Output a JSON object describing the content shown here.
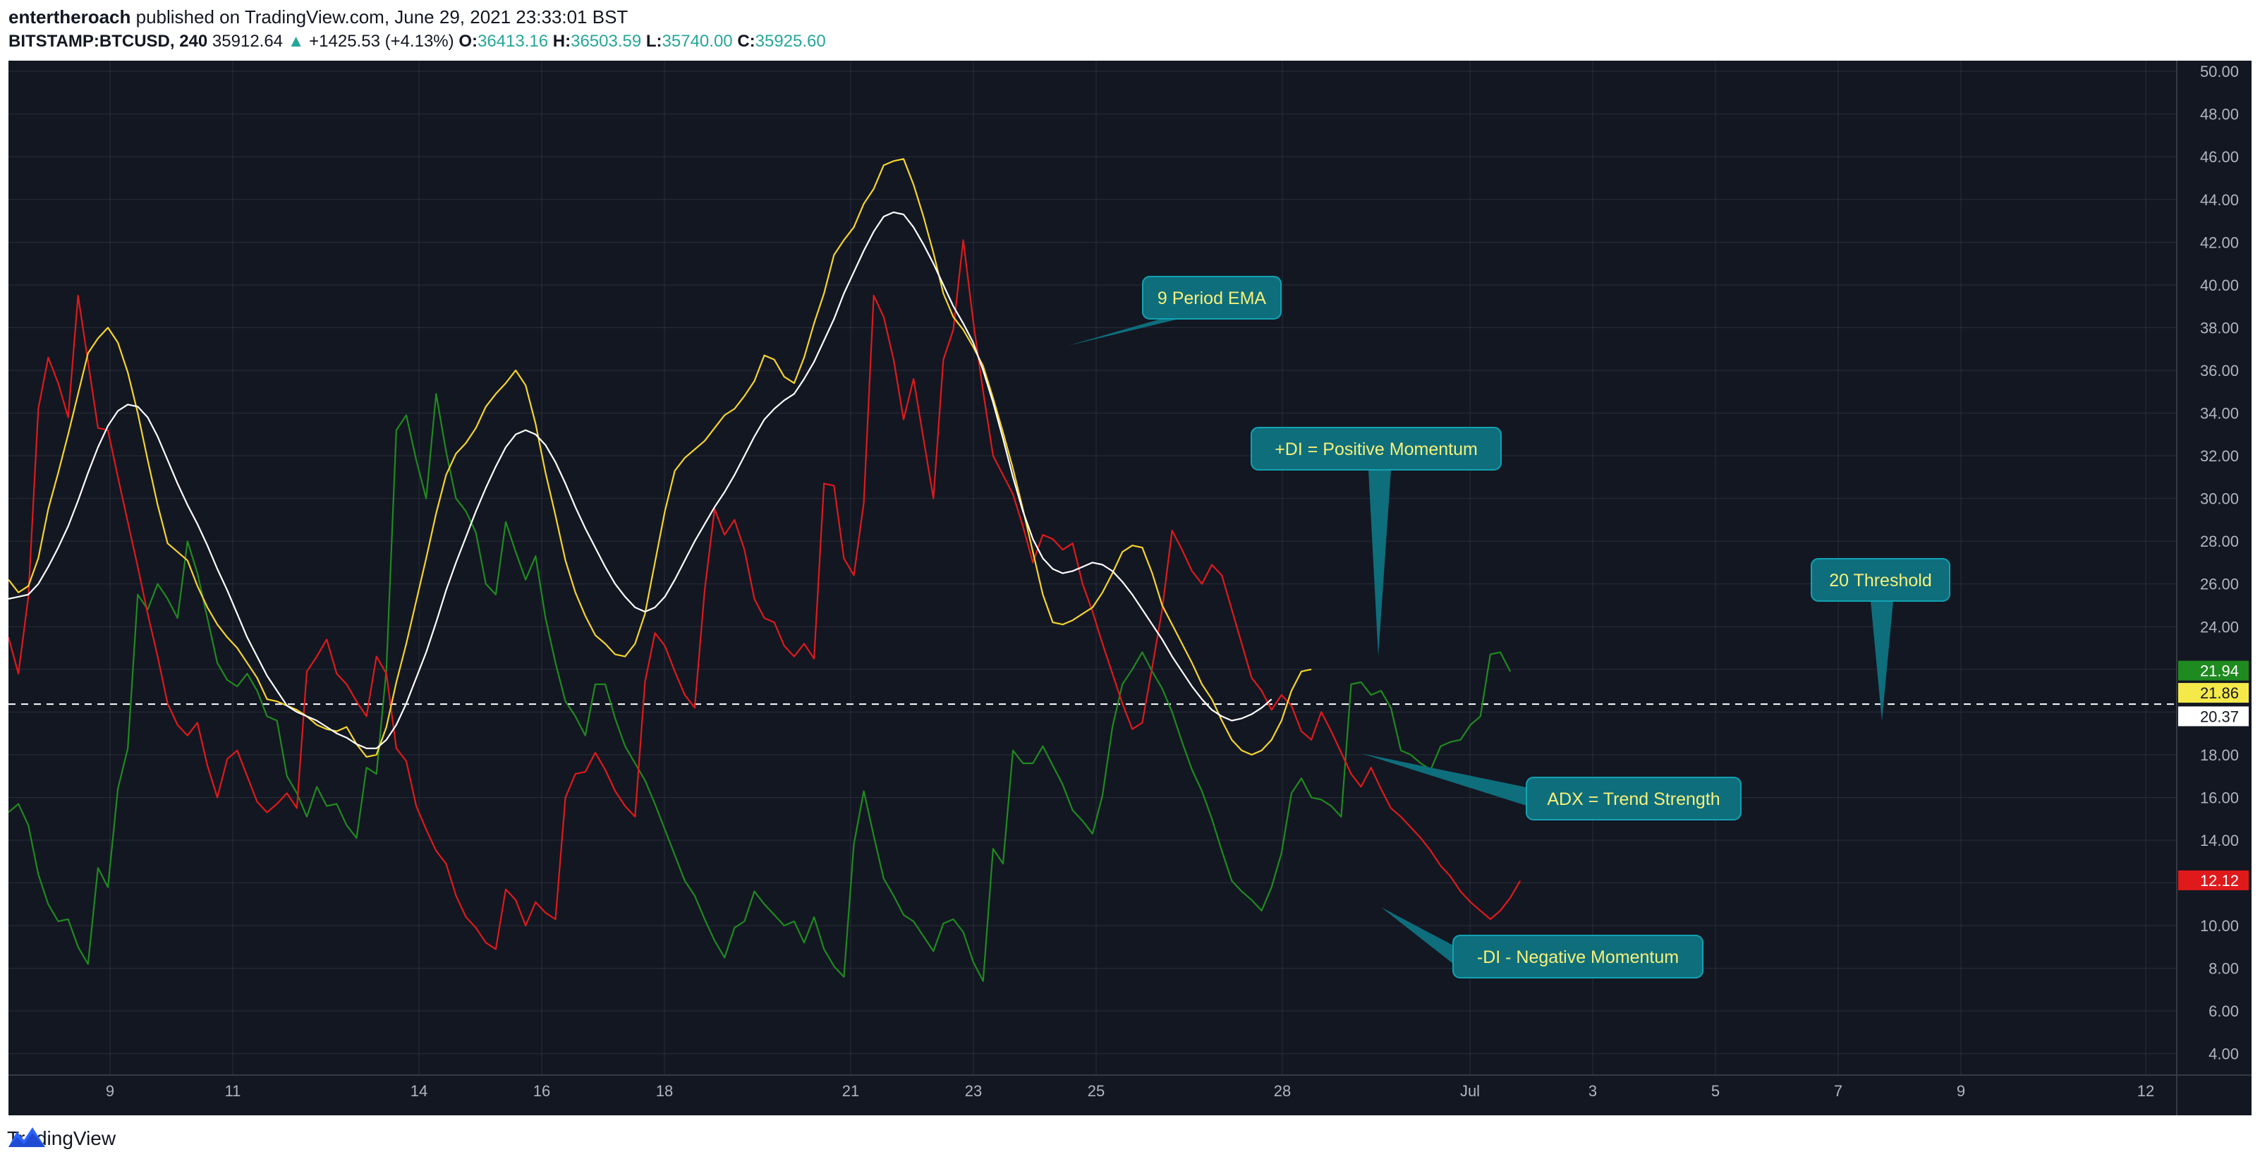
{
  "header": {
    "author": "entertheroach",
    "published_text": "published on TradingView.com, June 29, 2021 23:33:01 BST",
    "symbol": "BITSTAMP:BTCUSD, 240",
    "price": "35912.64",
    "change": "+1425.53 (+4.13%)",
    "o_label": "O:",
    "o_value": "36413.16",
    "h_label": "H:",
    "h_value": "36503.59",
    "l_label": "L:",
    "l_value": "35740.00",
    "c_label": "C:",
    "c_value": "35925.60",
    "up_arrow_icon": "triangle-up-icon"
  },
  "footer": {
    "brand": "TradingView",
    "logo_icon": "tradingview-logo-icon"
  },
  "colors": {
    "background": "#131722",
    "grid": "#2a2e39",
    "plus_di": "#1f8a1f",
    "minus_di": "#e0191b",
    "adx": "#f5d42c",
    "ema": "#ffffff",
    "annotation_bg": "#0e6e7c",
    "annotation_text": "#f5f07a",
    "axis_text": "#b2b5be"
  },
  "chart_data": {
    "type": "line",
    "x_axis_labels": [
      "9",
      "11",
      "14",
      "16",
      "18",
      "21",
      "23",
      "25",
      "28",
      "Jul",
      "3",
      "5",
      "7",
      "9",
      "12"
    ],
    "y_axis_labels": [
      "4.00",
      "6.00",
      "8.00",
      "10.00",
      "12.00",
      "14.00",
      "16.00",
      "18.00",
      "20.00",
      "22.00",
      "24.00",
      "26.00",
      "28.00",
      "30.00",
      "32.00",
      "34.00",
      "36.00",
      "38.00",
      "40.00",
      "42.00",
      "44.00",
      "46.00",
      "48.00",
      "50.00"
    ],
    "ylim": [
      3.0,
      50.5
    ],
    "threshold": 20.37,
    "last_value_labels": [
      {
        "text": "21.94",
        "value": 21.94,
        "bg": "#1f8a1f",
        "fg": "#ffffff"
      },
      {
        "text": "21.86",
        "value": 20.9,
        "bg": "#f5e94a",
        "fg": "#131722"
      },
      {
        "text": "20.37",
        "value": 19.8,
        "bg": "#ffffff",
        "fg": "#131722"
      },
      {
        "text": "12.12",
        "value": 12.12,
        "bg": "#e0191b",
        "fg": "#ffffff"
      }
    ],
    "series": [
      {
        "key": "plus_di",
        "values": [
          15.3,
          15.7,
          14.7,
          12.4,
          11.0,
          10.2,
          10.3,
          9.0,
          8.2,
          12.7,
          11.8,
          16.4,
          18.3,
          25.5,
          24.8,
          26.0,
          25.3,
          24.4,
          28.0,
          26.5,
          24.4,
          22.3,
          21.5,
          21.2,
          21.8,
          21.0,
          19.8,
          19.6,
          17.0,
          16.2,
          15.1,
          16.5,
          15.6,
          15.7,
          14.7,
          14.1,
          17.4,
          17.1,
          22.0,
          33.2,
          33.9,
          31.8,
          30.0,
          34.9,
          32.2,
          30.0,
          29.4,
          28.4,
          26.0,
          25.5,
          28.9,
          27.5,
          26.2,
          27.3,
          24.4,
          22.3,
          20.5,
          19.8,
          18.9,
          21.3,
          21.3,
          19.7,
          18.4,
          17.6,
          16.8,
          15.7,
          14.5,
          13.3,
          12.1,
          11.4,
          10.3,
          9.3,
          8.5,
          9.9,
          10.2,
          11.6,
          11.0,
          10.5,
          10.0,
          10.2,
          9.2,
          10.4,
          8.9,
          8.1,
          7.6,
          13.8,
          16.3,
          14.2,
          12.2,
          11.4,
          10.5,
          10.2,
          9.5,
          8.8,
          10.1,
          10.3,
          9.7,
          8.3,
          7.4,
          13.6,
          12.9,
          18.2,
          17.6,
          17.6,
          18.4,
          17.5,
          16.6,
          15.4,
          14.9,
          14.3,
          16.1,
          19.3,
          21.3,
          22.0,
          22.8,
          21.9,
          21.1,
          20.0,
          18.6,
          17.3,
          16.3,
          15.0,
          13.5,
          12.1,
          11.6,
          11.2,
          10.7,
          11.8,
          13.4,
          16.2,
          16.9,
          16.0,
          15.9,
          15.6,
          15.1,
          21.3,
          21.4,
          20.8,
          21.0,
          20.2,
          18.2,
          18.0,
          17.6,
          17.3,
          18.4,
          18.6,
          18.7,
          19.4,
          19.8,
          22.7,
          22.8,
          21.9
        ]
      },
      {
        "key": "minus_di",
        "values": [
          23.5,
          21.8,
          25.4,
          34.2,
          36.6,
          35.4,
          33.8,
          39.5,
          36.4,
          33.3,
          33.2,
          31.0,
          28.9,
          26.8,
          24.6,
          22.6,
          20.4,
          19.4,
          18.9,
          19.5,
          17.5,
          16.0,
          17.8,
          18.2,
          17.0,
          15.8,
          15.3,
          15.7,
          16.2,
          15.5,
          21.9,
          22.6,
          23.4,
          21.8,
          21.3,
          20.5,
          19.8,
          22.6,
          21.8,
          18.3,
          17.7,
          15.6,
          14.5,
          13.5,
          12.9,
          11.4,
          10.4,
          9.9,
          9.2,
          8.9,
          11.7,
          11.2,
          10.0,
          11.1,
          10.6,
          10.3,
          16.0,
          17.1,
          17.2,
          18.1,
          17.3,
          16.3,
          15.6,
          15.1,
          21.4,
          23.7,
          23.1,
          21.9,
          20.8,
          20.2,
          25.7,
          29.5,
          28.3,
          29.0,
          27.6,
          25.3,
          24.4,
          24.2,
          23.1,
          22.6,
          23.2,
          22.5,
          30.7,
          30.6,
          27.2,
          26.4,
          29.8,
          39.5,
          38.5,
          36.5,
          33.7,
          35.6,
          32.8,
          30.0,
          36.5,
          37.9,
          42.1,
          38.3,
          35.0,
          32.0,
          31.1,
          30.2,
          28.7,
          27.0,
          28.3,
          28.1,
          27.6,
          27.9,
          26.0,
          24.7,
          23.2,
          21.8,
          20.4,
          19.2,
          19.5,
          22.1,
          24.8,
          28.5,
          27.6,
          26.6,
          26.0,
          26.9,
          26.4,
          24.8,
          23.2,
          21.6,
          21.0,
          20.1,
          20.8,
          20.3,
          19.1,
          18.7,
          20.0,
          19.1,
          18.1,
          17.1,
          16.5,
          17.4,
          16.4,
          15.5,
          15.1,
          14.6,
          14.1,
          13.5,
          12.8,
          12.3,
          11.6,
          11.1,
          10.7,
          10.3,
          10.7,
          11.3,
          12.1
        ]
      },
      {
        "key": "adx",
        "values": [
          26.2,
          25.6,
          25.9,
          27.2,
          29.5,
          31.2,
          33.0,
          34.9,
          36.8,
          37.5,
          38.0,
          37.3,
          35.9,
          34.0,
          31.8,
          29.7,
          27.9,
          27.5,
          27.1,
          25.9,
          24.9,
          24.1,
          23.5,
          23.0,
          22.3,
          21.6,
          20.6,
          20.5,
          20.3,
          20.1,
          19.8,
          19.4,
          19.2,
          19.1,
          19.3,
          18.5,
          17.9,
          18.0,
          19.3,
          21.4,
          23.2,
          25.2,
          27.2,
          29.3,
          31.1,
          32.1,
          32.6,
          33.3,
          34.3,
          34.9,
          35.4,
          36.0,
          35.3,
          33.5,
          31.2,
          29.2,
          27.1,
          25.6,
          24.5,
          23.6,
          23.2,
          22.7,
          22.6,
          23.2,
          24.6,
          27.0,
          29.4,
          31.3,
          31.9,
          32.3,
          32.7,
          33.3,
          33.9,
          34.2,
          34.8,
          35.5,
          36.7,
          36.5,
          35.7,
          35.4,
          36.6,
          38.2,
          39.6,
          41.4,
          42.1,
          42.7,
          43.8,
          44.5,
          45.6,
          45.8,
          45.9,
          44.7,
          43.2,
          41.5,
          39.6,
          38.5,
          37.9,
          37.1,
          36.2,
          34.7,
          33.1,
          31.4,
          29.5,
          27.5,
          25.5,
          24.2,
          24.1,
          24.3,
          24.6,
          24.9,
          25.6,
          26.5,
          27.5,
          27.8,
          27.7,
          26.5,
          25.0,
          24.1,
          23.2,
          22.3,
          21.3,
          20.6,
          19.6,
          18.7,
          18.2,
          18.0,
          18.2,
          18.7,
          19.6,
          21.0,
          21.9,
          22.0
        ]
      },
      {
        "key": "ema",
        "values": [
          25.3,
          25.4,
          25.5,
          26.0,
          26.8,
          27.7,
          28.7,
          29.9,
          31.2,
          32.4,
          33.4,
          34.1,
          34.4,
          34.3,
          33.8,
          32.9,
          31.8,
          30.7,
          29.7,
          28.8,
          27.8,
          26.7,
          25.7,
          24.6,
          23.5,
          22.6,
          21.7,
          21.0,
          20.3,
          20.0,
          19.8,
          19.6,
          19.3,
          19.0,
          18.8,
          18.5,
          18.3,
          18.3,
          18.7,
          19.4,
          20.4,
          21.6,
          22.8,
          24.2,
          25.7,
          27.0,
          28.2,
          29.4,
          30.5,
          31.5,
          32.4,
          33.0,
          33.2,
          33.0,
          32.5,
          31.7,
          30.7,
          29.6,
          28.6,
          27.7,
          26.8,
          26.0,
          25.4,
          24.9,
          24.7,
          24.9,
          25.4,
          26.2,
          27.1,
          28.0,
          28.8,
          29.6,
          30.3,
          31.1,
          32.0,
          32.9,
          33.7,
          34.2,
          34.6,
          34.9,
          35.6,
          36.4,
          37.4,
          38.4,
          39.6,
          40.6,
          41.6,
          42.5,
          43.2,
          43.4,
          43.3,
          42.7,
          41.9,
          41.0,
          40.0,
          39.0,
          38.2,
          37.3,
          36.0,
          34.5,
          32.8,
          31.0,
          29.4,
          28.1,
          27.2,
          26.7,
          26.5,
          26.6,
          26.8,
          27.0,
          26.9,
          26.6,
          26.1,
          25.5,
          24.8,
          24.1,
          23.4,
          22.6,
          21.9,
          21.2,
          20.6,
          20.1,
          19.8,
          19.6,
          19.7,
          19.9,
          20.2,
          20.6
        ]
      }
    ]
  },
  "annotations": [
    {
      "text": "9 Period EMA"
    },
    {
      "text": "+DI = Positive Momentum"
    },
    {
      "text": "20 Threshold"
    },
    {
      "text": "ADX = Trend Strength"
    },
    {
      "text": "-DI - Negative Momentum"
    }
  ]
}
